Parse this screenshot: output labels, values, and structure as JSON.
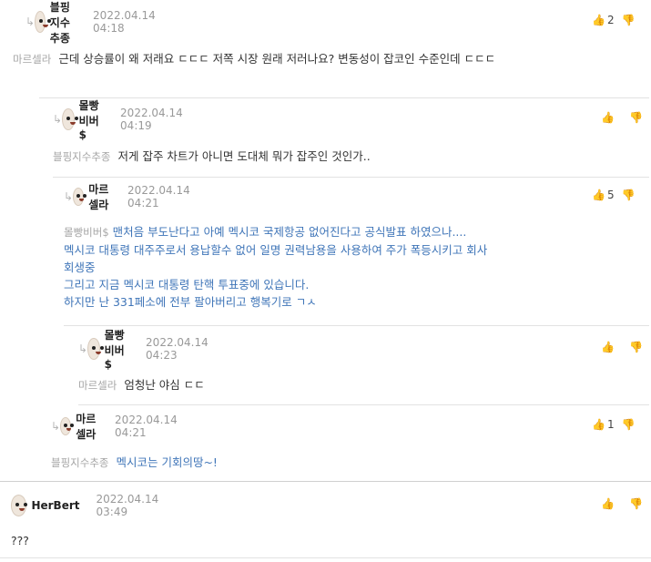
{
  "comments": [
    {
      "user": "블핑지수추종",
      "date": "2022.04.14 04:18",
      "likes": "2",
      "mention": "마르셀라",
      "text": "근데 상승률이 왜 저래요 ㄷㄷㄷ 저쪽 시장 원래 저러나요? 변동성이 잡코인 수준인데 ㄷㄷㄷ"
    },
    {
      "user": "몰빵비버$",
      "date": "2022.04.14 04:19",
      "likes": "",
      "mention": "블핑지수추종",
      "text": "저게 잡주 차트가 아니면 도대체 뭐가 잡주인 것인가.."
    },
    {
      "user": "마르셀라",
      "date": "2022.04.14 04:21",
      "likes": "5",
      "mention": "몰빵비버$",
      "lines": [
        "맨처음 부도난다고 아예 멕시코 국제항공 없어진다고 공식발표 하였으나....",
        "멕시코 대통령 대주주로서 용납할수 없어 일명 권력남용을 사용하여 주가 폭등시키고 회사",
        "회생중",
        "그리고 지금 멕시코 대통령 탄핵 투표중에 있습니다.",
        "하지만 난 331페소에 전부 팔아버리고 행복기로 ㄱㅅ"
      ]
    },
    {
      "user": "몰빵비버$",
      "date": "2022.04.14 04:23",
      "likes": "",
      "mention": "마르셀라",
      "text": "엄청난 야심 ㄷㄷ"
    },
    {
      "user": "마르셀라",
      "date": "2022.04.14 04:21",
      "likes": "1",
      "mention": "블핑지수추종",
      "text": "멕시코는 기회의땅~!"
    },
    {
      "user": "HerBert",
      "date": "2022.04.14 03:49",
      "likes": "",
      "text": "???"
    }
  ],
  "icons": {
    "reply_arrow": "reply-arrow-icon",
    "like": "thumbs-up-icon",
    "dislike": "thumbs-down-icon"
  },
  "colors": {
    "accent_blue": "#3f75b8",
    "mention_gray": "#a5a5a5",
    "date_gray": "#999999"
  }
}
